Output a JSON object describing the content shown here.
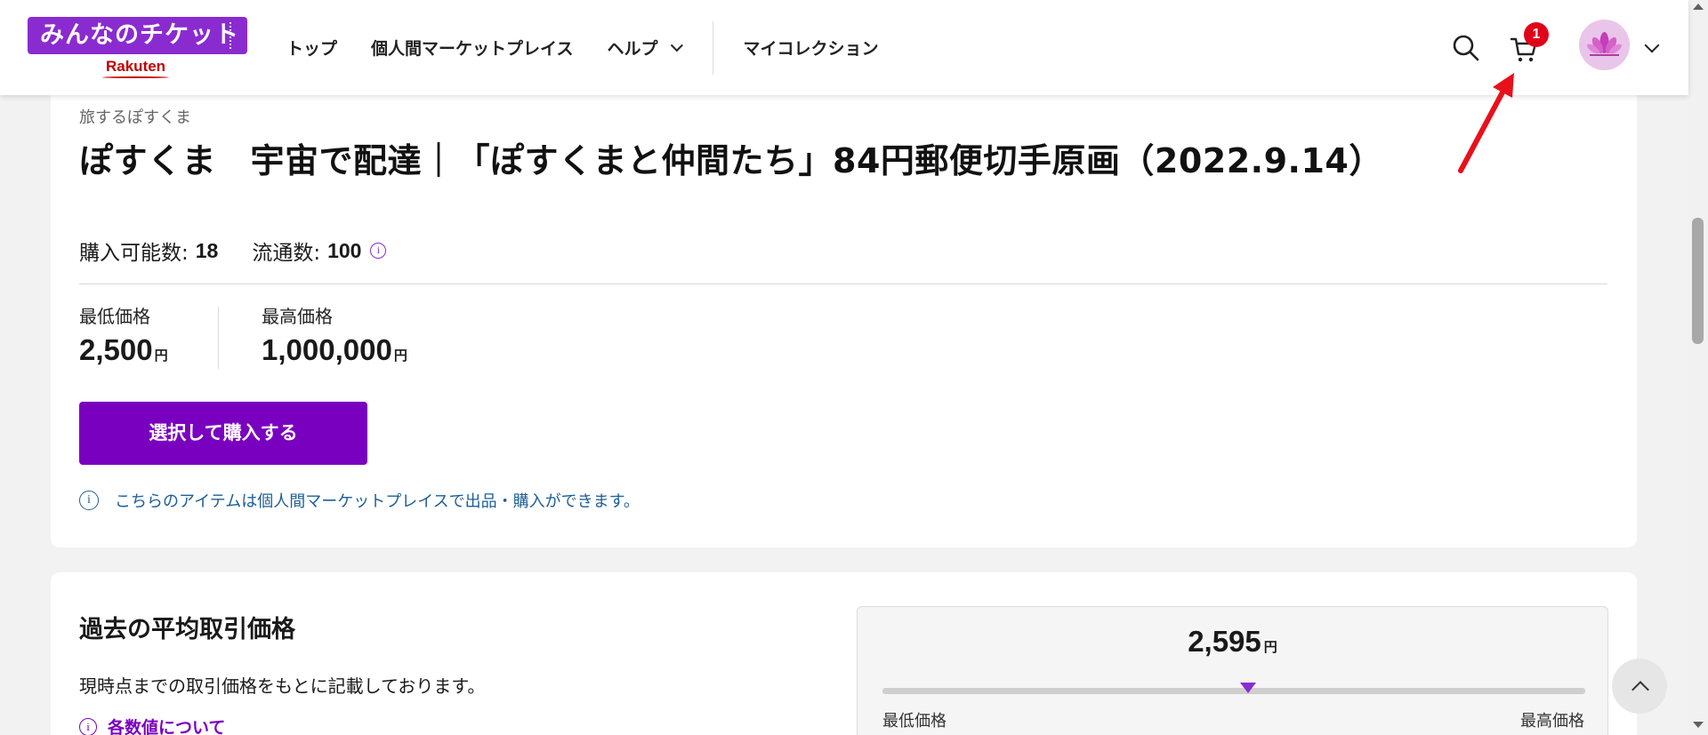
{
  "header": {
    "logo_text": "みんなのチケット",
    "logo_sub": "Rakuten",
    "nav": [
      {
        "label": "トップ"
      },
      {
        "label": "個人間マーケットプレイス"
      },
      {
        "label": "ヘルプ"
      },
      {
        "label": "マイコレクション"
      }
    ],
    "cart_count": "1",
    "icons": [
      "search-icon",
      "cart-icon",
      "avatar",
      "chevron-down-icon"
    ]
  },
  "item": {
    "creator": "旅するぽすくま",
    "title": "ぽすくま　宇宙で配達｜「ぽすくまと仲間たち」84円郵便切手原画（2022.9.14）",
    "available_label": "購入可能数:",
    "available_value": "18",
    "circulation_label": "流通数:",
    "circulation_value": "100",
    "min_price_label": "最低価格",
    "min_price_value": "2,500",
    "max_price_label": "最高価格",
    "max_price_value": "1,000,000",
    "yen": "円",
    "buy_button": "選択して購入する",
    "notice": "こちらのアイテムは個人間マーケットプレイスで出品・購入ができます。"
  },
  "average": {
    "title": "過去の平均取引価格",
    "description": "現時点までの取引価格をもとに記載しております。",
    "about_link": "各数値について",
    "value": "2,595",
    "min_label": "最低価格",
    "max_label": "最高価格",
    "marker_position_fraction": 0.52
  },
  "colors": {
    "brand_purple": "#7a00c0",
    "badge_red": "#e0001a",
    "notice_blue": "#1d5f95",
    "annotation_arrow": "#e8101a"
  }
}
